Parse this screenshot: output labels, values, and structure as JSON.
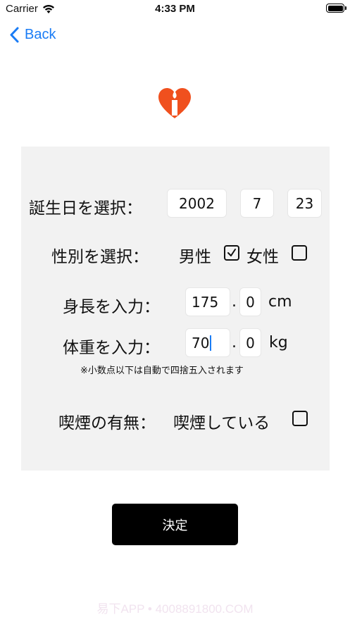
{
  "status_bar": {
    "carrier": "Carrier",
    "time": "4:33 PM"
  },
  "nav": {
    "back_label": "Back"
  },
  "accent_color": "#1a7cf5",
  "logo_color": "#f0501e",
  "form": {
    "birthday": {
      "label": "誕生日を選択：",
      "year": "2002",
      "month": "7",
      "day": "23"
    },
    "gender": {
      "label": "性別を選択：",
      "male": "男性",
      "female": "女性",
      "male_checked": true,
      "female_checked": false
    },
    "height": {
      "label": "身長を入力：",
      "int": "175",
      "sep": ".",
      "dec": "0",
      "unit": "cm"
    },
    "weight": {
      "label": "体重を入力：",
      "int": "70",
      "sep": ".",
      "dec": "0",
      "unit": "kg"
    },
    "note": "※小数点以下は自動で四捨五入されます",
    "smoking": {
      "label": "喫煙の有無：",
      "option": "喫煙している",
      "checked": false
    }
  },
  "submit_label": "決定",
  "watermark": "易下APP • 4008891800.COM"
}
